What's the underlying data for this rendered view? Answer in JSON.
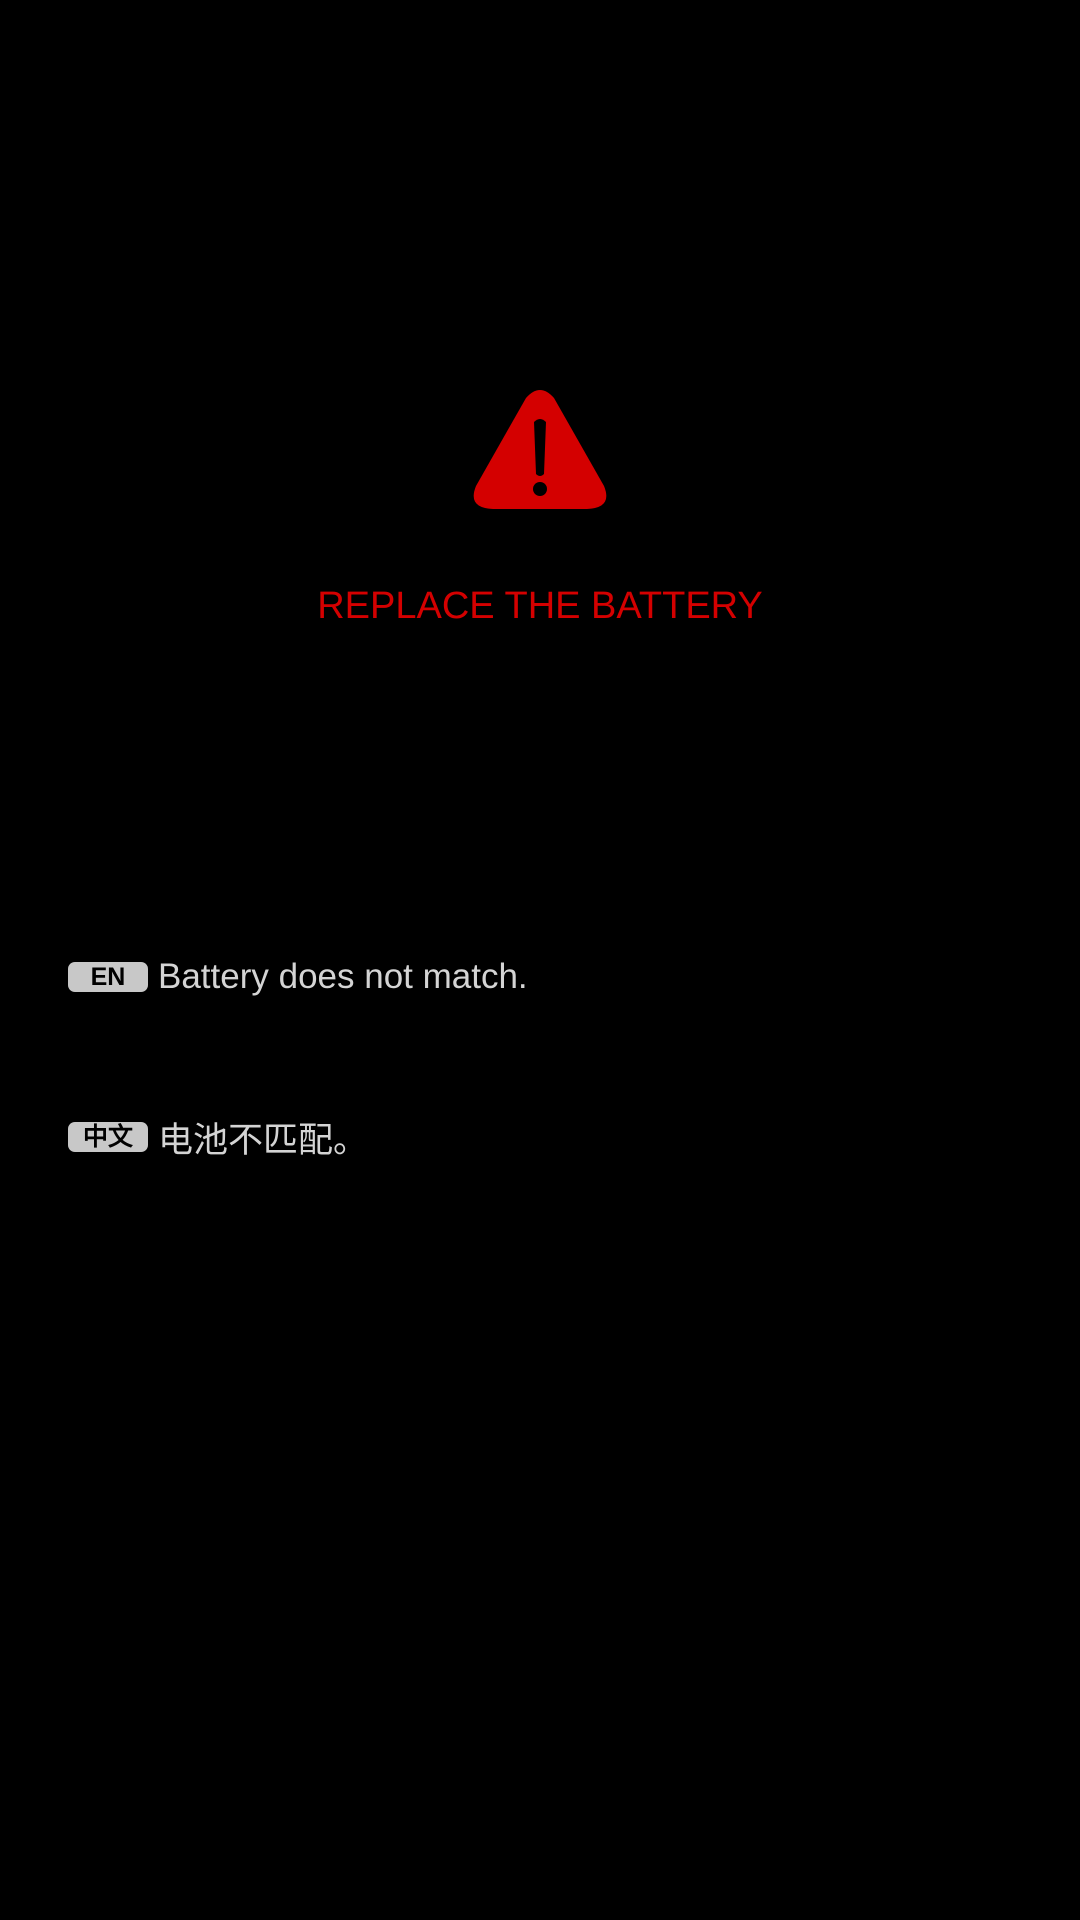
{
  "icon": {
    "name": "warning-triangle-icon",
    "color": "#d40000"
  },
  "title": "REPLACE THE BATTERY",
  "messages": [
    {
      "lang": "EN",
      "text": "Battery does not match."
    },
    {
      "lang": "中文",
      "text": "电池不匹配。"
    }
  ],
  "colors": {
    "background": "#000000",
    "accent": "#d40000",
    "badge_bg": "#c8c8c8",
    "text": "#d4d4d4"
  }
}
